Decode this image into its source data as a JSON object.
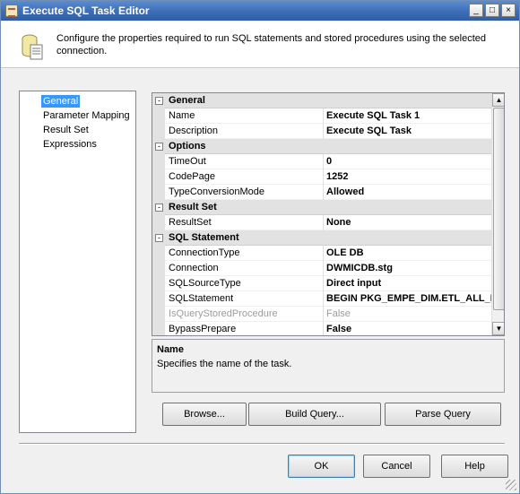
{
  "window": {
    "title": "Execute SQL Task Editor",
    "controls": [
      "_",
      "□",
      "×"
    ]
  },
  "header": {
    "description": "Configure the properties required to run SQL statements and stored procedures using the selected connection."
  },
  "nav": {
    "items": [
      "General",
      "Parameter Mapping",
      "Result Set",
      "Expressions"
    ],
    "selected": "General"
  },
  "grid": {
    "categories": {
      "general": "General",
      "options": "Options",
      "result_set": "Result Set",
      "sql_statement": "SQL Statement"
    },
    "props": {
      "name": {
        "label": "Name",
        "value": "Execute SQL Task 1"
      },
      "description": {
        "label": "Description",
        "value": "Execute SQL Task"
      },
      "timeout": {
        "label": "TimeOut",
        "value": "0"
      },
      "codepage": {
        "label": "CodePage",
        "value": "1252"
      },
      "typeconversion": {
        "label": "TypeConversionMode",
        "value": "Allowed"
      },
      "resultset": {
        "label": "ResultSet",
        "value": "None"
      },
      "connectiontype": {
        "label": "ConnectionType",
        "value": "OLE DB"
      },
      "connection": {
        "label": "Connection",
        "value": "DWMICDB.stg"
      },
      "sqlsourcetype": {
        "label": "SQLSourceType",
        "value": "Direct input"
      },
      "sqlstatement": {
        "label": "SQLStatement",
        "value": "BEGIN  PKG_EMPE_DIM.ETL_ALL_I"
      },
      "isquerystored": {
        "label": "IsQueryStoredProcedure",
        "value": "False"
      },
      "bypassprepare": {
        "label": "BypassPrepare",
        "value": "False"
      }
    }
  },
  "desc_panel": {
    "title": "Name",
    "text": "Specifies the name of the task."
  },
  "buttons": {
    "browse": "Browse...",
    "build_query": "Build Query...",
    "parse_query": "Parse Query",
    "ok": "OK",
    "cancel": "Cancel",
    "help": "Help"
  },
  "colors": {
    "titlebar": "#3f6fb8",
    "selection": "#3399ff",
    "category_bg": "#e2e2e2"
  }
}
